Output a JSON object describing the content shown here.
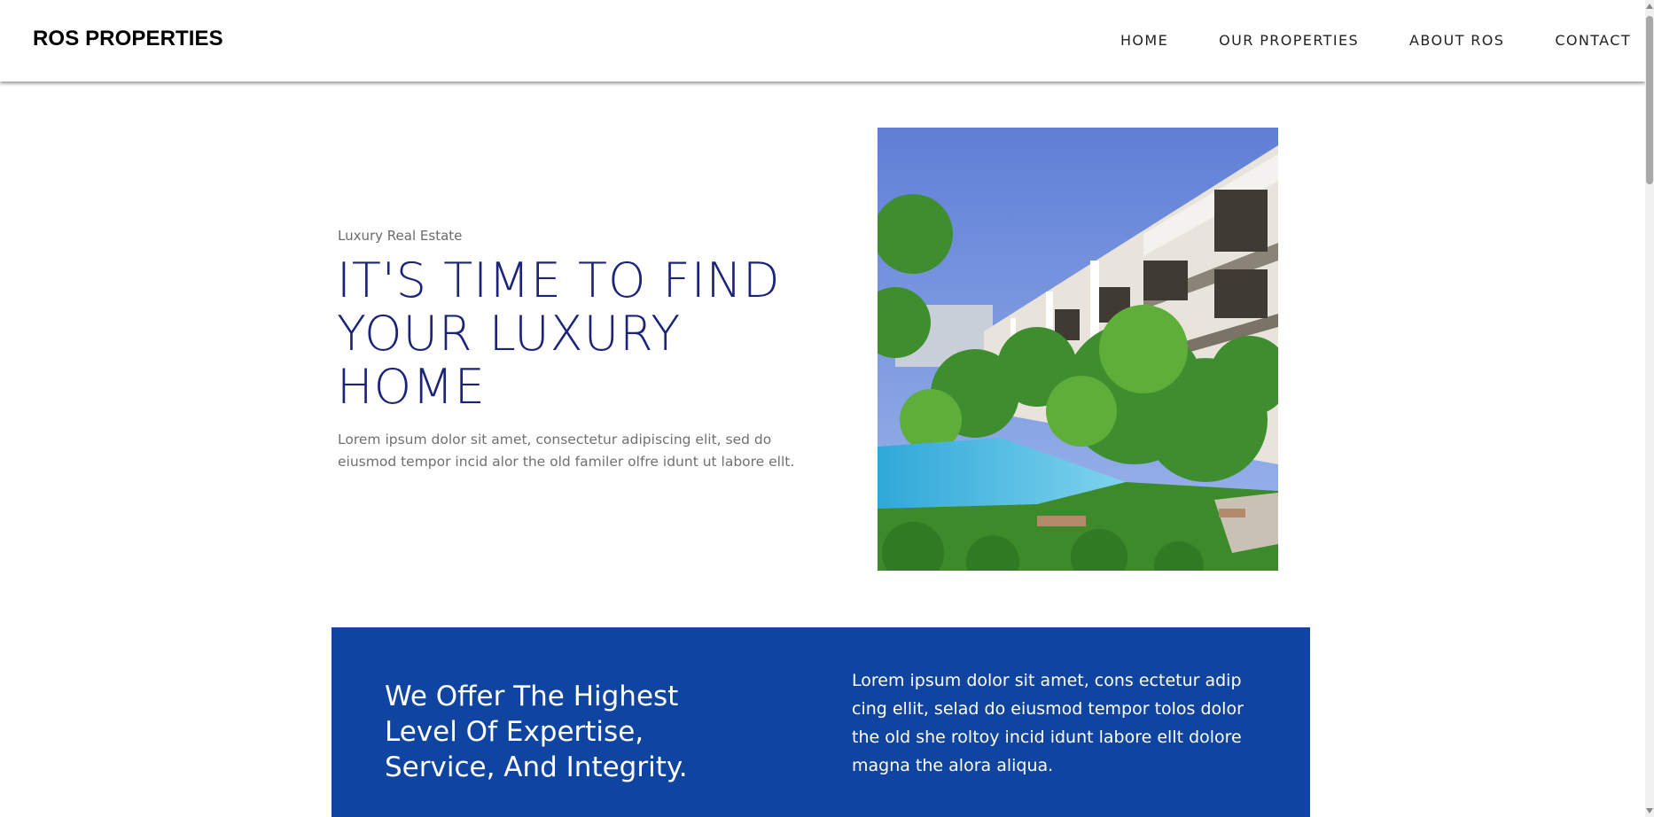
{
  "header": {
    "brand": "ROS PROPERTIES",
    "nav": [
      "HOME",
      "OUR PROPERTIES",
      "ABOUT ROS",
      "CONTACT"
    ]
  },
  "hero": {
    "eyebrow": "Luxury Real Estate",
    "title_lines": [
      "IT'S TIME TO FIND",
      "YOUR LUXURY",
      "HOME"
    ],
    "body_lines": [
      "Lorem ipsum dolor sit amet, consectetur adipiscing elit, sed do",
      "eiusmod tempor incid alor the old familer olfre idunt ut labore ellt."
    ]
  },
  "offer": {
    "title_lines": [
      "We Offer The Highest",
      "Level Of Expertise,",
      "Service, And Integrity."
    ],
    "body_lines": [
      "Lorem ipsum dolor sit amet, cons ectetur adip",
      "cing ellit, selad do eiusmod tempor tolos dolor",
      "the old she roltoy incid idunt labore ellt dolore",
      "magna the alora aliqua."
    ]
  },
  "colors": {
    "title": "#1b237a",
    "band": "#0f45a0",
    "body_text": "#707070"
  },
  "icons": {
    "scroll_up": "triangle-up-icon",
    "scroll_down": "triangle-down-icon"
  }
}
